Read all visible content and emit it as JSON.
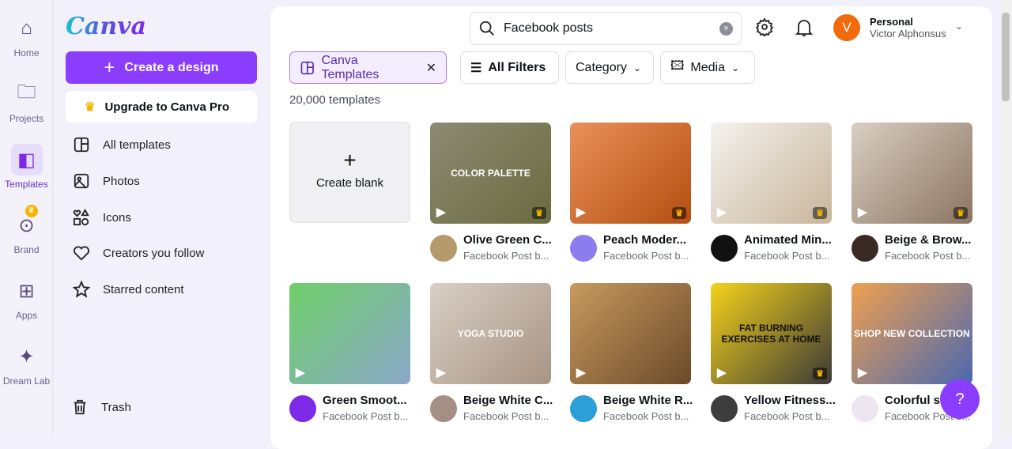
{
  "rail": [
    {
      "label": "Home",
      "icon": "home-icon"
    },
    {
      "label": "Projects",
      "icon": "folder-icon"
    },
    {
      "label": "Templates",
      "icon": "templates-icon",
      "active": true
    },
    {
      "label": "Brand",
      "icon": "brand-icon"
    },
    {
      "label": "Apps",
      "icon": "apps-icon"
    },
    {
      "label": "Dream Lab",
      "icon": "dream-lab-icon"
    }
  ],
  "panel": {
    "logo": "Canva",
    "create": "Create a design",
    "upgrade": "Upgrade to Canva Pro",
    "nav": [
      "All templates",
      "Photos",
      "Icons",
      "Creators you follow",
      "Starred content"
    ],
    "trash": "Trash"
  },
  "search": {
    "value": "Facebook posts",
    "clear": "×"
  },
  "account": {
    "initial": "V",
    "type": "Personal",
    "name": "Victor Alphonsus"
  },
  "filters": {
    "canva_templates": "Canva Templates",
    "all_filters": "All Filters",
    "category": "Category",
    "media": "Media"
  },
  "count": "20,000 templates",
  "blank": {
    "plus": "+",
    "label": "Create blank"
  },
  "cards": [
    {
      "title": "Olive Green C...",
      "sub": "Facebook Post b...",
      "thumb": "COLOR PALETTE",
      "colors": [
        "#8c8a73",
        "#6b6b3f"
      ],
      "avatar": "#b79a6c"
    },
    {
      "title": "Peach Moder...",
      "sub": "Facebook Post b...",
      "thumb": "",
      "colors": [
        "#e9905a",
        "#b34f10"
      ],
      "avatar": "#8d7cf0"
    },
    {
      "title": "Animated Min...",
      "sub": "Facebook Post b...",
      "thumb": "",
      "colors": [
        "#f4f2ef",
        "#c8b59a"
      ],
      "avatar": "#111111"
    },
    {
      "title": "Beige & Brow...",
      "sub": "Facebook Post b...",
      "thumb": "",
      "colors": [
        "#d9cfc3",
        "#8a7460"
      ],
      "avatar": "#3a2a26"
    },
    {
      "title": "Green Smoot...",
      "sub": "Facebook Post b...",
      "thumb": "",
      "colors": [
        "#6fcf6a",
        "#8aa7c9"
      ],
      "avatar": "#7d2ae8"
    },
    {
      "title": "Beige White C...",
      "sub": "Facebook Post b...",
      "thumb": "YOGA STUDIO",
      "colors": [
        "#d8cfc6",
        "#a89483"
      ],
      "avatar": "#a58e84"
    },
    {
      "title": "Beige White R...",
      "sub": "Facebook Post b...",
      "thumb": "",
      "colors": [
        "#c79a5e",
        "#6b4a2a"
      ],
      "avatar": "#2a9fd8"
    },
    {
      "title": "Yellow Fitness...",
      "sub": "Facebook Post b...",
      "thumb": "FAT BURNING EXERCISES AT HOME",
      "colors": [
        "#f5d21a",
        "#3c3a36"
      ],
      "avatar": "#3d3d3d"
    },
    {
      "title": "Colorful s...",
      "sub": "Facebook Post b...",
      "thumb": "SHOP NEW COLLECTION",
      "colors": [
        "#f0a050",
        "#4a68b0"
      ],
      "avatar": "#ede6f0"
    }
  ],
  "help": "?"
}
